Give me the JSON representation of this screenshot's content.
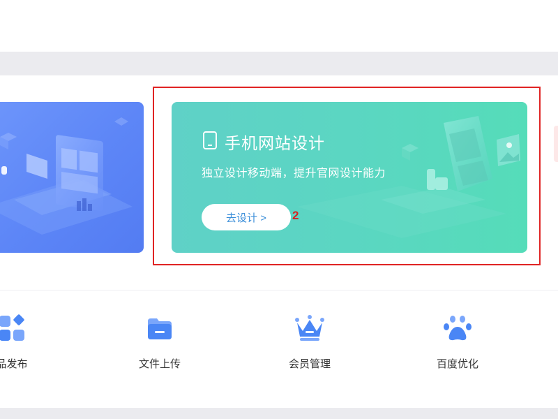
{
  "feature_card": {
    "title": "手机网站设计",
    "subtitle": "独立设计移动端，提升官网设计能力",
    "button_label": "去设计 >"
  },
  "callout": {
    "number": "2"
  },
  "quick_links": [
    {
      "label": "品发布",
      "icon": "grid-shapes-icon"
    },
    {
      "label": "文件上传",
      "icon": "folder-icon"
    },
    {
      "label": "会员管理",
      "icon": "crown-icon"
    },
    {
      "label": "百度优化",
      "icon": "paw-icon"
    }
  ],
  "colors": {
    "accent_blue": "#4a86f5",
    "card_green": "#5bd6c2",
    "card_blue": "#5d86f7",
    "highlight_red": "#e02424"
  }
}
